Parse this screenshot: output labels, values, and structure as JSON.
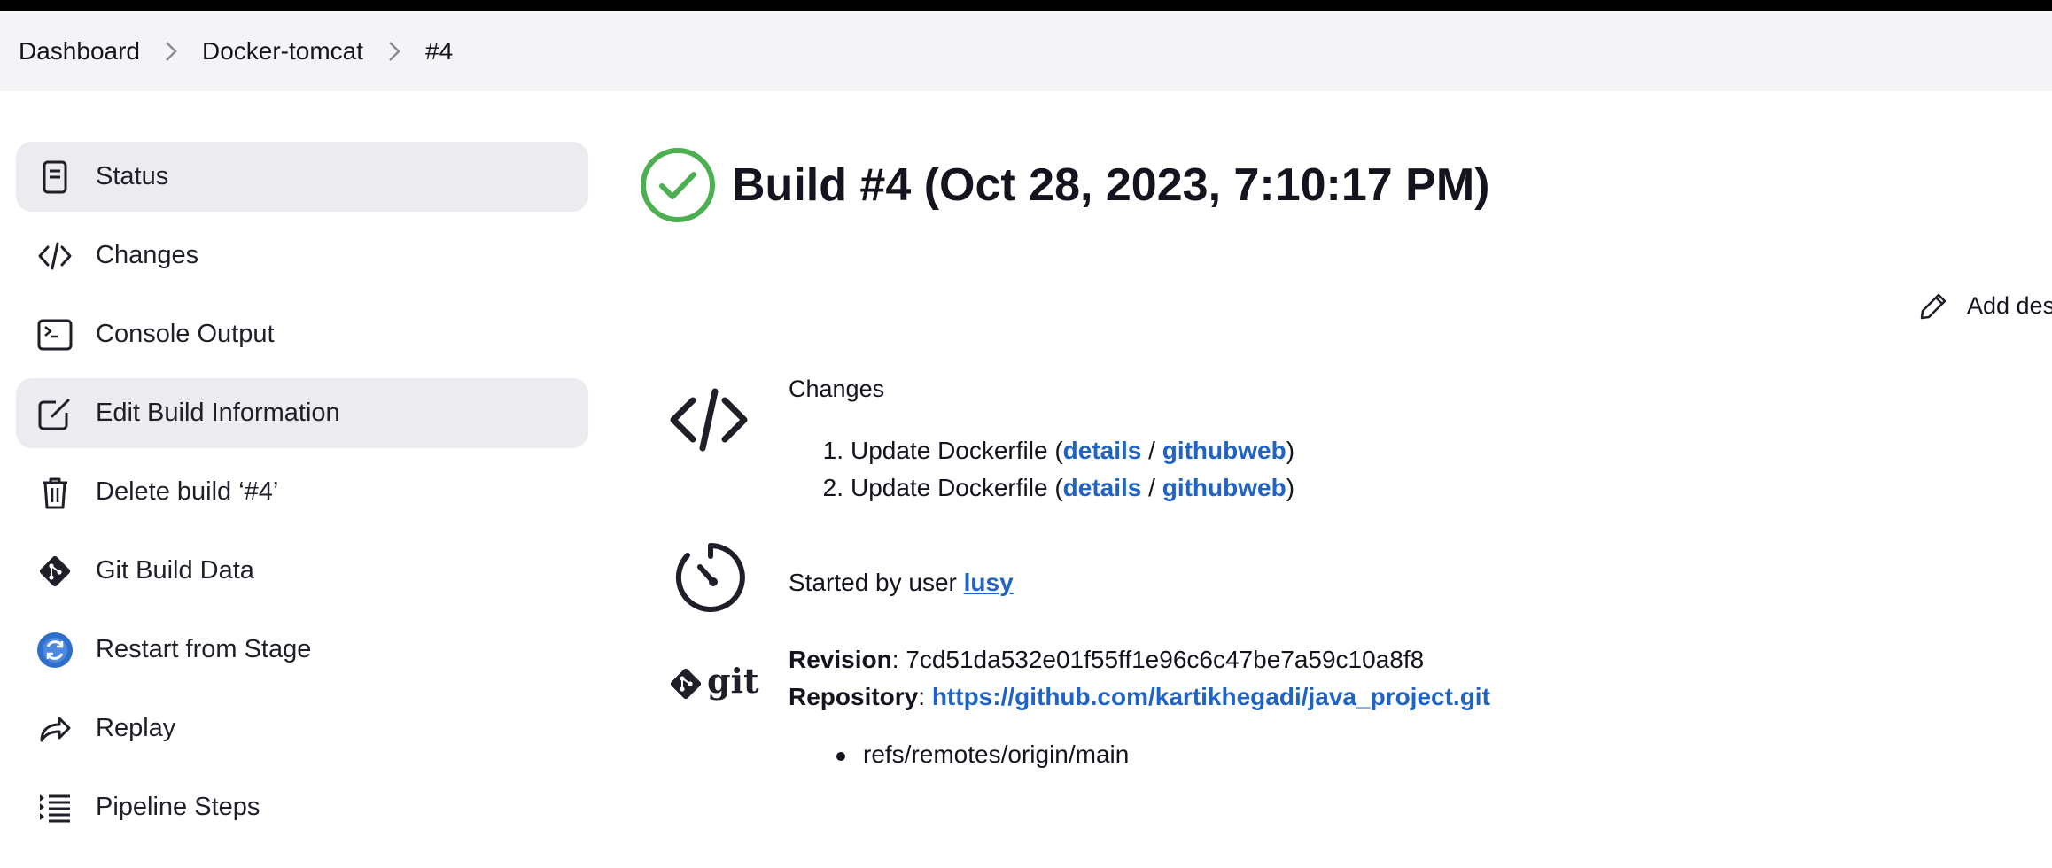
{
  "breadcrumb": {
    "items": [
      {
        "label": "Dashboard"
      },
      {
        "label": "Docker-tomcat"
      },
      {
        "label": "#4"
      }
    ]
  },
  "sidebar": {
    "items": [
      {
        "label": "Status",
        "icon": "document-icon",
        "active": true
      },
      {
        "label": "Changes",
        "icon": "code-icon",
        "active": false
      },
      {
        "label": "Console Output",
        "icon": "terminal-icon",
        "active": false
      },
      {
        "label": "Edit Build Information",
        "icon": "edit-icon",
        "active": true
      },
      {
        "label": "Delete build ‘#4’",
        "icon": "trash-icon",
        "active": false
      },
      {
        "label": "Git Build Data",
        "icon": "git-icon",
        "active": false
      },
      {
        "label": "Restart from Stage",
        "icon": "restart-icon",
        "active": false
      },
      {
        "label": "Replay",
        "icon": "replay-icon",
        "active": false
      },
      {
        "label": "Pipeline Steps",
        "icon": "pipeline-steps-icon",
        "active": false
      }
    ]
  },
  "build": {
    "title": "Build #4 (Oct 28, 2023, 7:10:17 PM)",
    "status": "success",
    "add_description": "Add des"
  },
  "changes": {
    "heading": "Changes",
    "items": [
      {
        "number": "1.",
        "text": "Update Dockerfile",
        "details": "details",
        "sep": "/",
        "githubweb": "githubweb"
      },
      {
        "number": "2.",
        "text": "Update Dockerfile",
        "details": "details",
        "sep": "/",
        "githubweb": "githubweb"
      }
    ]
  },
  "started": {
    "prefix": "Started by user",
    "user": "lusy"
  },
  "git": {
    "revision_label": "Revision",
    "revision": "7cd51da532e01f55ff1e96c6c47be7a59c10a8f8",
    "repository_label": "Repository",
    "repository": "https://github.com/kartikhegadi/java_project.git",
    "refs": [
      "refs/remotes/origin/main"
    ],
    "logo_text": "git"
  },
  "colors": {
    "success": "#4caf50",
    "link": "#1f63c6",
    "restart_icon": "#2d6fcb",
    "sidebar_active": "#ebebf0",
    "breadcrumb_bg": "#f4f4f6"
  }
}
